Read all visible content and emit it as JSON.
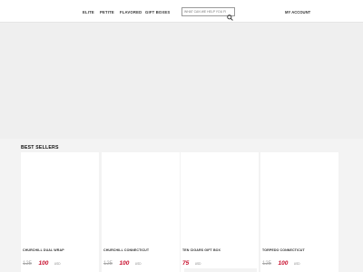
{
  "nav": {
    "items": [
      {
        "label": "ELITE"
      },
      {
        "label": "PETITE"
      },
      {
        "label": "FLAVORED"
      },
      {
        "label": "GIFT BOXES"
      }
    ],
    "account_label": "MY ACCOUNT"
  },
  "search": {
    "placeholder": "WHAT CAN WE HELP YOU FIND?",
    "icon": "search-icon"
  },
  "best_sellers": {
    "title": "BEST SELLERS",
    "products": [
      {
        "name": "CHURCHILL DUAL WRAP",
        "old_price": "125",
        "price": "100",
        "unit": "USD"
      },
      {
        "name": "CHURCHILL CONNECTICUT",
        "old_price": "125",
        "price": "100",
        "unit": "USD"
      },
      {
        "name": "TEN CIGARS GIFT BOX",
        "old_price": "",
        "price": "75",
        "unit": "USD"
      },
      {
        "name": "TORPEDO CONNECTICUT",
        "old_price": "125",
        "price": "100",
        "unit": "USD"
      }
    ]
  },
  "colors": {
    "price_red": "#c8102e",
    "background": "#f3f3f3"
  }
}
